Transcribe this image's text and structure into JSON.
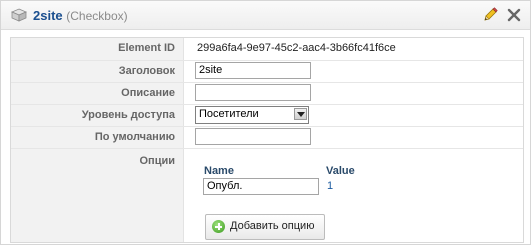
{
  "header": {
    "title": "2site",
    "subtitle": "(Checkbox)",
    "box_icon": "box-icon",
    "edit_icon": "pencil-icon",
    "close_icon": "close-icon"
  },
  "form": {
    "element_id_label": "Element ID",
    "element_id_value": "299a6fa4-9e97-45c2-aac4-3b66fc41f6ce",
    "title_label": "Заголовок",
    "title_value": "2site",
    "description_label": "Описание",
    "description_value": "",
    "access_label": "Уровень доступа",
    "access_value": "Посетители",
    "default_label": "По умолчанию",
    "default_value": "",
    "options_label": "Опции"
  },
  "options": {
    "name_header": "Name",
    "value_header": "Value",
    "rows": [
      {
        "name": "Опубл.",
        "value": "1"
      }
    ],
    "add_button_label": "Добавить опцию",
    "add_icon": "plus-icon"
  },
  "colors": {
    "title": "#1b4f8f",
    "label_bg": "#f2f2f2",
    "value_link": "#1b5aa0",
    "add_icon": "#3a9a1f"
  }
}
